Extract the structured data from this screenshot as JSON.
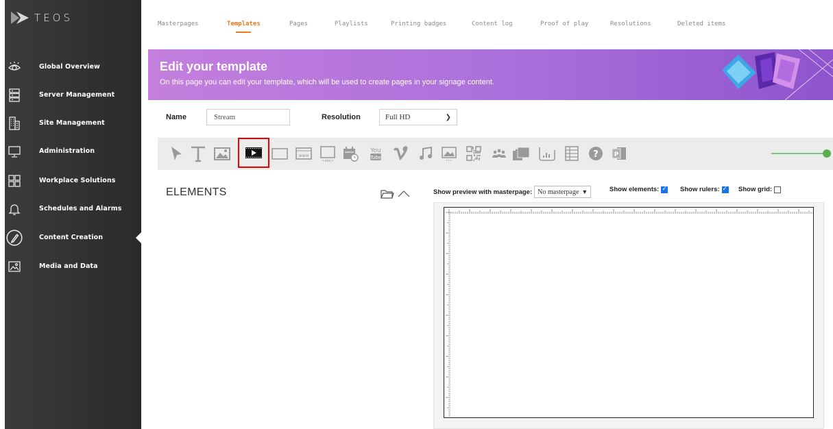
{
  "app": {
    "logo_text": "TEOS"
  },
  "sidebar": {
    "items": [
      {
        "label": "Global Overview",
        "icon": "eye-icon"
      },
      {
        "label": "Server Management",
        "icon": "server-icon"
      },
      {
        "label": "Site Management",
        "icon": "building-icon"
      },
      {
        "label": "Administration",
        "icon": "monitor-icon"
      },
      {
        "label": "Workplace Solutions",
        "icon": "grid-icon"
      },
      {
        "label": "Schedules and Alarms",
        "icon": "bell-icon"
      },
      {
        "label": "Content Creation",
        "icon": "pen-circle-icon",
        "active": true
      },
      {
        "label": "Media and Data",
        "icon": "image-icon"
      }
    ]
  },
  "tabs": [
    {
      "label": "Masterpages"
    },
    {
      "label": "Templates",
      "active": true
    },
    {
      "label": "Pages"
    },
    {
      "label": "Playlists"
    },
    {
      "label": "Printing badges"
    },
    {
      "label": "Content log"
    },
    {
      "label": "Proof of play"
    },
    {
      "label": "Resolutions"
    },
    {
      "label": "Deleted items"
    }
  ],
  "banner": {
    "title": "Edit your template",
    "subtitle": "On this page you can edit your template, which will be used to create pages in your signage content."
  },
  "form": {
    "name_label": "Name",
    "name_value": "Stream",
    "resolution_label": "Resolution",
    "resolution_value": "Full HD"
  },
  "toolbar": {
    "tools": [
      "pointer-tool-icon",
      "text-tool-icon",
      "image-tool-icon",
      "video-stream-tool-icon",
      "rectangle-tool-icon",
      "web-tool-icon",
      "ticker-tool-icon",
      "datetime-tool-icon",
      "youtube-tool-icon",
      "vimeo-tool-icon",
      "audio-tool-icon",
      "slideshow-tool-icon",
      "qr-code-tool-icon",
      "people-tool-icon",
      "layers-tool-icon",
      "chart-tool-icon",
      "table-tool-icon",
      "help-tool-icon",
      "powerpoint-tool-icon"
    ],
    "highlighted_tool": "video-stream-tool-icon"
  },
  "elements": {
    "title": "ELEMENTS"
  },
  "preview": {
    "masterpage_label": "Show preview with masterpage:",
    "masterpage_value": "No masterpage",
    "show_elements_label": "Show elements:",
    "show_elements": true,
    "show_rulers_label": "Show rulers:",
    "show_rulers": true,
    "show_grid_label": "Show grid:",
    "show_grid": false
  },
  "colors": {
    "accent": "#f07a1a",
    "banner_start": "#c47fdd",
    "banner_end": "#8d54cc",
    "highlight": "#ee0000"
  }
}
